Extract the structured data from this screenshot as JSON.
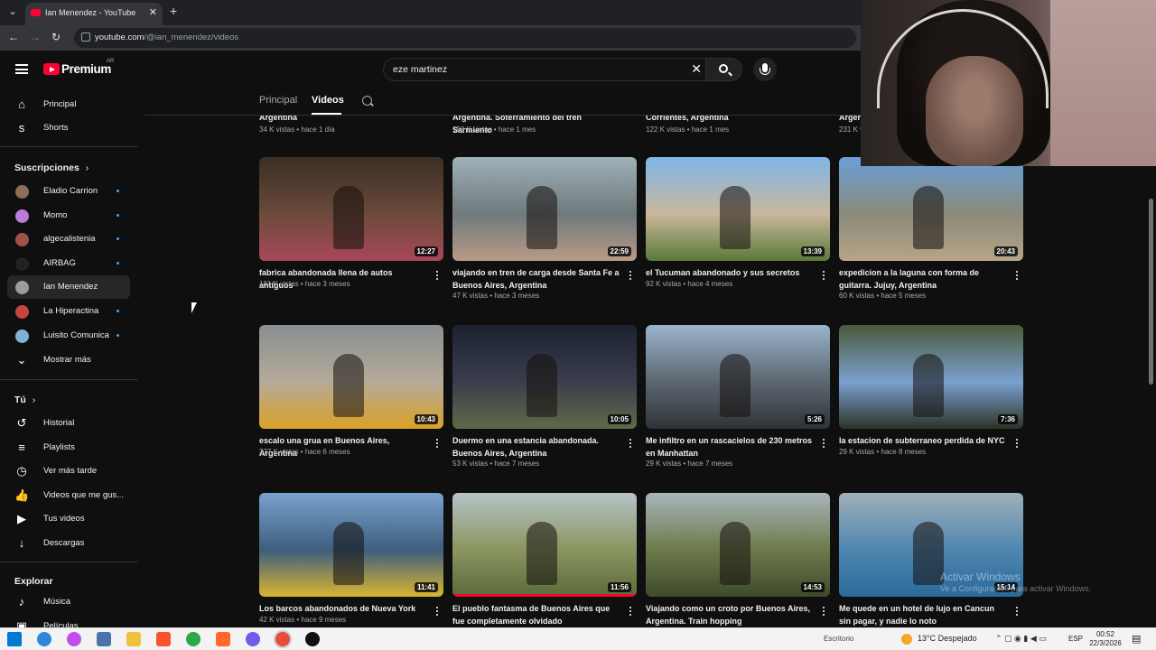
{
  "browser": {
    "tab_title": "Ian Menendez - YouTube",
    "url_host": "youtube.com",
    "url_path": "/@ian_menendez/videos"
  },
  "header": {
    "logo_text": "Premium",
    "logo_country": "AR",
    "search_value": "eze martinez"
  },
  "sidebar": {
    "main": [
      {
        "label": "Principal",
        "icon": "home-icon"
      },
      {
        "label": "Shorts",
        "icon": "shorts-icon"
      }
    ],
    "subscriptions_title": "Suscripciones",
    "subscriptions": [
      {
        "label": "Eladio Carrion",
        "avatar_color": "#8a6d5a",
        "new": true
      },
      {
        "label": "Momo",
        "avatar_color": "#b97cd9",
        "new": true
      },
      {
        "label": "algecalistenia",
        "avatar_color": "#a0524a",
        "new": true
      },
      {
        "label": "AIRBAG",
        "avatar_color": "#222222",
        "new": true
      },
      {
        "label": "Ian Menendez",
        "avatar_color": "#9c9c9c",
        "new": false
      },
      {
        "label": "La Hiperactina",
        "avatar_color": "#c9433f",
        "new": true
      },
      {
        "label": "Luisito Comunica",
        "avatar_color": "#7fb0d6",
        "new": true
      }
    ],
    "show_more": "Mostrar más",
    "you_title": "Tú",
    "you_items": [
      {
        "label": "Historial",
        "icon": "history-icon"
      },
      {
        "label": "Playlists",
        "icon": "playlists-icon"
      },
      {
        "label": "Ver más tarde",
        "icon": "watch-later-icon"
      },
      {
        "label": "Videos que me gus...",
        "icon": "liked-icon"
      },
      {
        "label": "Tus videos",
        "icon": "your-videos-icon"
      },
      {
        "label": "Descargas",
        "icon": "downloads-icon"
      }
    ],
    "explore_title": "Explorar",
    "explore_items": [
      {
        "label": "Música",
        "icon": "music-icon"
      },
      {
        "label": "Películas",
        "icon": "movies-icon"
      }
    ]
  },
  "channel_tabs": [
    {
      "label": "Principal",
      "active": false
    },
    {
      "label": "Videos",
      "active": true
    }
  ],
  "partial_row": [
    {
      "title": "Argentina",
      "meta": "34 K vistas • hace 1 día"
    },
    {
      "title": "Argentina. Soterramiento del tren Sarmiento",
      "meta": "193 K vistas • hace 1 mes"
    },
    {
      "title": "Corrientes, Argentina",
      "meta": "122 K vistas • hace 1 mes"
    },
    {
      "title": "Argentina",
      "meta": "231 K vistas • hace 1 mes"
    }
  ],
  "videos": [
    {
      "title": "fabrica abandonada llena de autos antiguos",
      "meta": "181 K vistas • hace 3 meses",
      "duration": "12:27",
      "watched": 0,
      "colors": [
        "#3a2e25",
        "#6b4a3a",
        "#a8485a"
      ]
    },
    {
      "title": "viajando en tren de carga desde Santa Fe a Buenos Aires, Argentina",
      "meta": "47 K vistas • hace 3 meses",
      "duration": "22:59",
      "watched": 0,
      "colors": [
        "#9fb0b8",
        "#6f7a7c",
        "#b89a86"
      ]
    },
    {
      "title": "el Tucuman abandonado y sus secretos",
      "meta": "92 K vistas • hace 4 meses",
      "duration": "13:39",
      "watched": 0,
      "colors": [
        "#7fb6e8",
        "#c9b79b",
        "#5a7a3a"
      ]
    },
    {
      "title": "expedicion a la laguna con forma de guitarra. Jujuy, Argentina",
      "meta": "60 K vistas • hace 5 meses",
      "duration": "20:43",
      "watched": 0,
      "colors": [
        "#6a9fd8",
        "#8b8a7a",
        "#b7a586"
      ]
    },
    {
      "title": "escalo una grua en Buenos Aires, Argentina",
      "meta": "277 K vistas • hace 6 meses",
      "duration": "10:43",
      "watched": 0,
      "colors": [
        "#8a8f93",
        "#b5aa98",
        "#d9a227"
      ]
    },
    {
      "title": "Duermo en una estancia abandonada. Buenos Aires, Argentina",
      "meta": "53 K vistas • hace 7 meses",
      "duration": "10:05",
      "watched": 0,
      "colors": [
        "#1c2230",
        "#3a3e4c",
        "#5e6a4a"
      ]
    },
    {
      "title": "Me infiltro en un rascacielos de 230 metros en Manhattan",
      "meta": "29 K vistas • hace 7 meses",
      "duration": "5:26",
      "watched": 0,
      "colors": [
        "#9ab4cc",
        "#5c6670",
        "#2f3338"
      ]
    },
    {
      "title": "la estacion de subterraneo perdida de NYC",
      "meta": "29 K vistas • hace 8 meses",
      "duration": "7:36",
      "watched": 0,
      "colors": [
        "#4a5a3a",
        "#7ba0d0",
        "#2c3324"
      ]
    },
    {
      "title": "Los barcos abandonados de Nueva York",
      "meta": "42 K vistas • hace 9 meses",
      "duration": "11:41",
      "watched": 0,
      "colors": [
        "#7aa2cf",
        "#3d5e7e",
        "#d9b531"
      ]
    },
    {
      "title": "El pueblo fantasma de Buenos Aires que fue completamente olvidado",
      "meta": "",
      "duration": "11:56",
      "watched": 1,
      "colors": [
        "#b6c3c7",
        "#8a9560",
        "#5c6a3a"
      ]
    },
    {
      "title": "Viajando como un croto por Buenos Aires, Argentina. Train hopping",
      "meta": "",
      "duration": "14:53",
      "watched": 0,
      "colors": [
        "#a9b6bb",
        "#6c7a4a",
        "#3e4a2c"
      ]
    },
    {
      "title": "Me quede en un hotel de lujo en Cancun sin pagar, y nadie lo noto",
      "meta": "",
      "duration": "15:14",
      "watched": 0,
      "colors": [
        "#9fb0b8",
        "#4f86b0",
        "#2a6a9a"
      ]
    }
  ],
  "watermark": {
    "title": "Activar Windows",
    "subtitle": "Ve a Configuración para activar Windows."
  },
  "taskbar": {
    "search_text": "Escritorio",
    "weather": "13°C  Despejado",
    "lang": "ESP",
    "time": "00:52",
    "date": "22/3/2026"
  }
}
